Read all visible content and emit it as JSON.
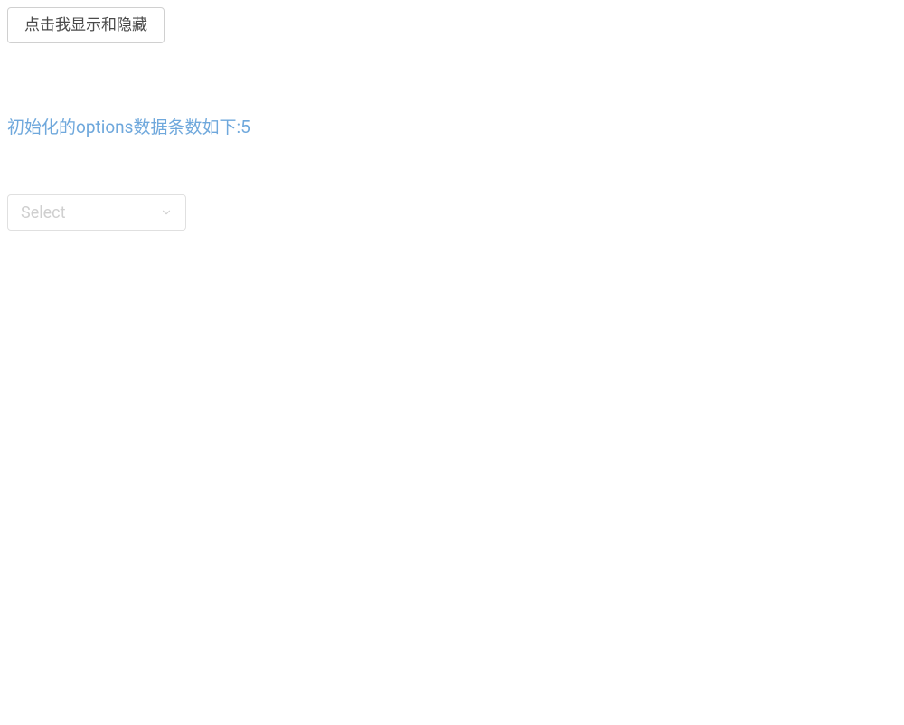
{
  "button": {
    "toggle_label": "点击我显示和隐藏"
  },
  "status": {
    "text": "初始化的options数据条数如下:5"
  },
  "select": {
    "placeholder": "Select",
    "options_count": 5
  }
}
